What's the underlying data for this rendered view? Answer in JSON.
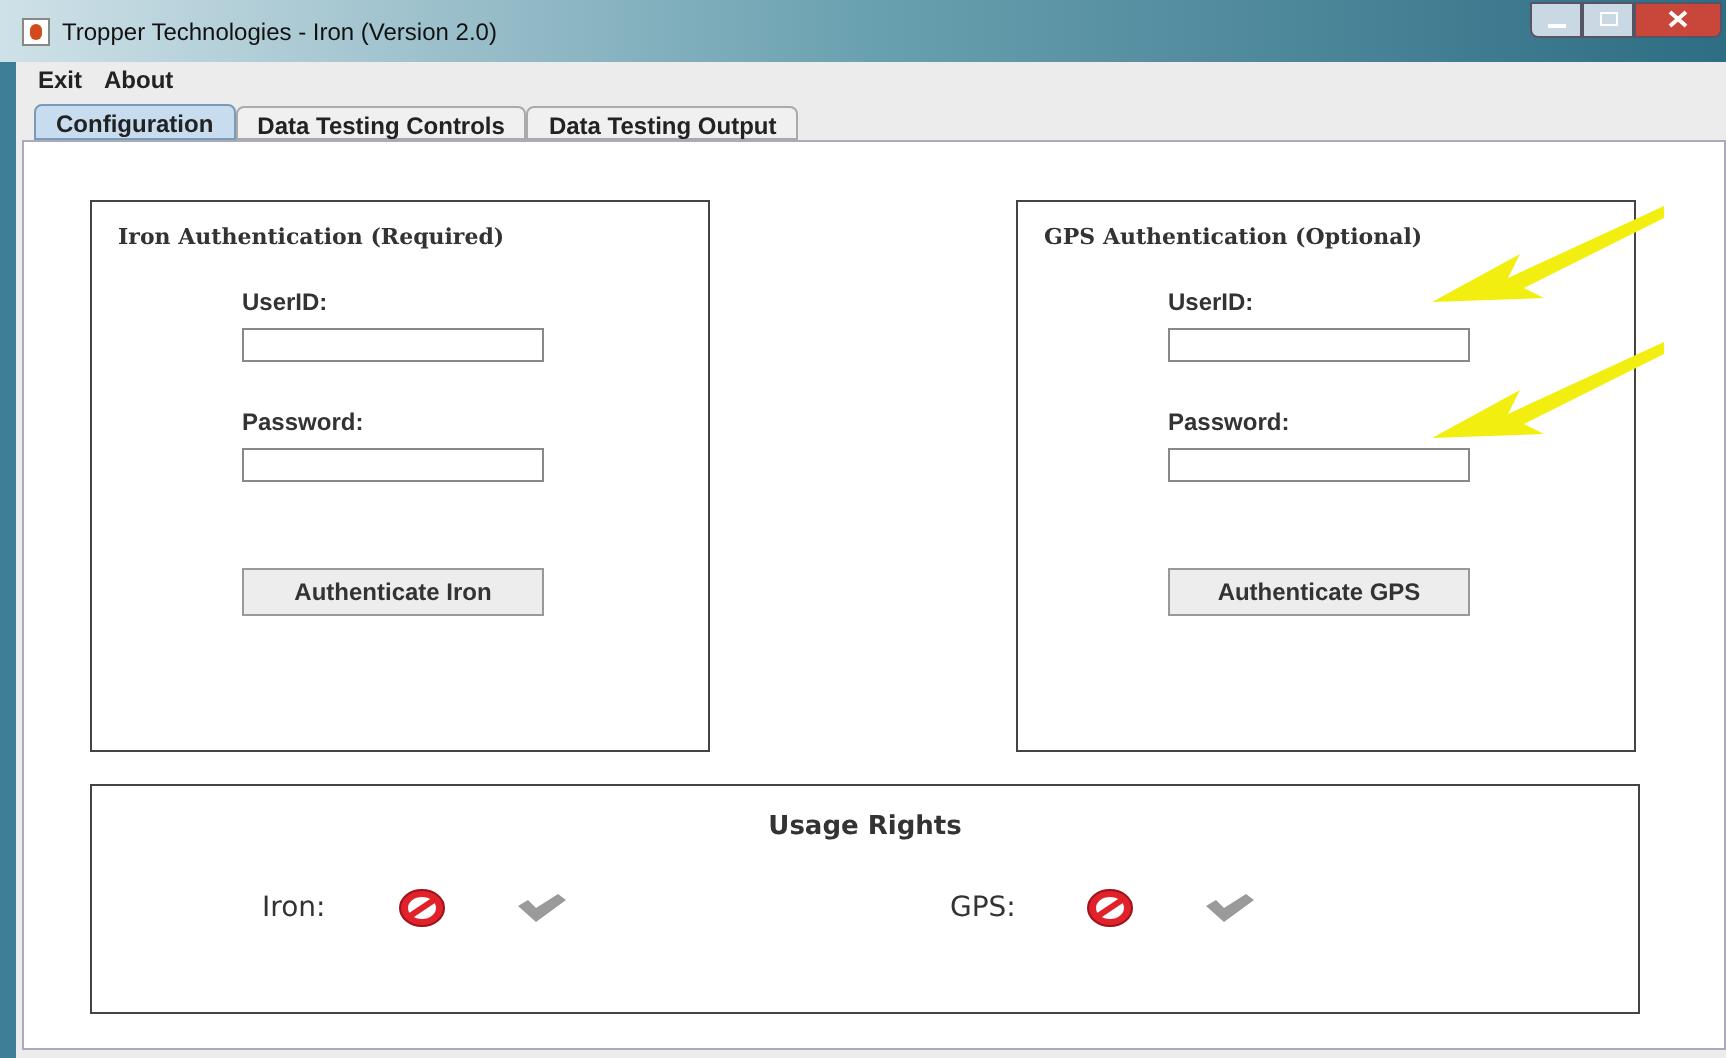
{
  "window": {
    "title": "Tropper Technologies - Iron (Version 2.0)"
  },
  "menu": [
    "Exit",
    "About"
  ],
  "tabs": [
    {
      "label": "Configuration",
      "selected": true
    },
    {
      "label": "Data Testing Controls",
      "selected": false
    },
    {
      "label": "Data Testing Output",
      "selected": false
    }
  ],
  "panels": [
    {
      "title": "Iron Authentication (Required)",
      "fields": [
        {
          "label": "UserID:"
        },
        {
          "label": "Password:"
        }
      ],
      "button": "Authenticate Iron",
      "annotated": false
    },
    {
      "title": "GPS Authentication (Optional)",
      "fields": [
        {
          "label": "UserID:"
        },
        {
          "label": "Password:"
        }
      ],
      "button": "Authenticate GPS",
      "annotated": true
    }
  ],
  "usage_rights": {
    "title": "Usage Rights",
    "items": [
      {
        "label": "Iron:",
        "granted": false
      },
      {
        "label": "GPS:",
        "granted": false
      }
    ]
  }
}
